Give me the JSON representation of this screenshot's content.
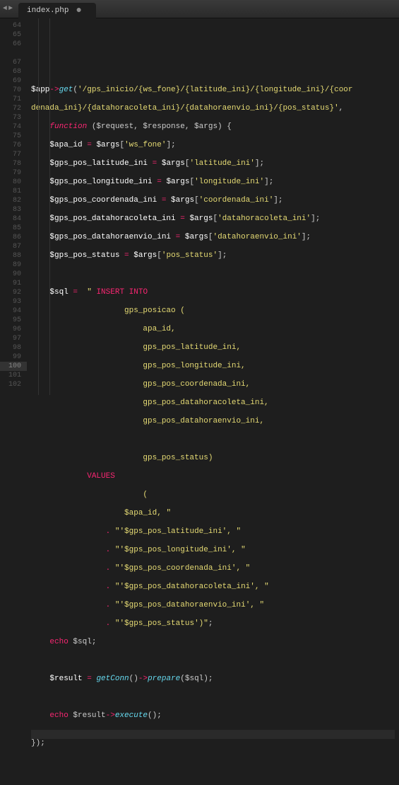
{
  "tab": {
    "filename": "index.php",
    "dirty_marker": "●"
  },
  "nav": {
    "left": "◄",
    "right": "►"
  },
  "gutter": {
    "lines": [
      "64",
      "65",
      "66",
      "",
      "67",
      "68",
      "69",
      "70",
      "71",
      "72",
      "73",
      "74",
      "75",
      "76",
      "77",
      "78",
      "79",
      "80",
      "81",
      "82",
      "83",
      "84",
      "85",
      "86",
      "87",
      "88",
      "89",
      "90",
      "91",
      "92",
      "93",
      "94",
      "95",
      "96",
      "97",
      "98",
      "99",
      "100",
      "101",
      "102"
    ],
    "active_line": "100"
  },
  "code": {
    "l66a": "$app",
    "l66b": "->",
    "l66c": "get",
    "l66d": "(",
    "l66e": "'/gps_inicio/{ws_fone}/{latitude_ini}/{longitude_ini}/{coordenada_ini}/{datahoracoleta_ini}/{datahoraenvio_ini}/{pos_status}'",
    "l66f": ",",
    "l66g": "function",
    "l66h": " ($request, $response, $args) {",
    "l68a": "$apa_id",
    "l68b": " = ",
    "l68c": "$args",
    "l68d": "[",
    "l68e": "'ws_fone'",
    "l68f": "];",
    "l69a": "$gps_pos_latitude_ini",
    "l69e": "'latitude_ini'",
    "l70a": "$gps_pos_longitude_ini",
    "l70e": "'longitude_ini'",
    "l71a": "$gps_pos_coordenada_ini",
    "l71e": "'coordenada_ini'",
    "l72a": "$gps_pos_datahoracoleta_ini",
    "l72e": "'datahoracoleta_ini'",
    "l73a": "$gps_pos_datahoraenvio_ini",
    "l73e": "'datahoraenvio_ini'",
    "l74a": "$gps_pos_status",
    "l74e": "'pos_status'",
    "l76a": "$sql",
    "l76b": " = ",
    "l76c": "\" ",
    "l76d": "INSERT INTO",
    "l77": "                    gps_posicao (",
    "l78": "                        apa_id,",
    "l79": "                        gps_pos_latitude_ini,",
    "l80": "                        gps_pos_longitude_ini,",
    "l81": "                        gps_pos_coordenada_ini,",
    "l82": "                        gps_pos_datahoracoleta_ini,",
    "l83": "                        gps_pos_datahoraenvio_ini,",
    "l85": "                        gps_pos_status)",
    "l86": "VALUES",
    "l87": "                        (",
    "l88a": "                    $apa_id",
    "l88b": ", ",
    "l88c": "\"",
    "l89a": "\"'",
    "l89b": "$gps_pos_latitude_ini",
    "l89c": "', \"",
    "l90b": "$gps_pos_longitude_ini",
    "l91b": "$gps_pos_coordenada_ini",
    "l92b": "$gps_pos_datahoracoleta_ini",
    "l93b": "$gps_pos_datahoraenvio_ini",
    "l94b": "$gps_pos_status",
    "l94c": "')\"",
    "l95a": "echo",
    "l95b": " $sql;",
    "l97a": "$result",
    "l97b": " = ",
    "l97c": "getConn",
    "l97d": "()",
    "l97e": "->",
    "l97f": "prepare",
    "l97g": "($sql);",
    "l99a": "echo",
    "l99b": " $result",
    "l99c": "->",
    "l99d": "execute",
    "l99e": "();",
    "l101": "});",
    "dot": ".",
    "eq": " = ",
    "args": "$args",
    "br_open": "[",
    "br_close": "];"
  }
}
